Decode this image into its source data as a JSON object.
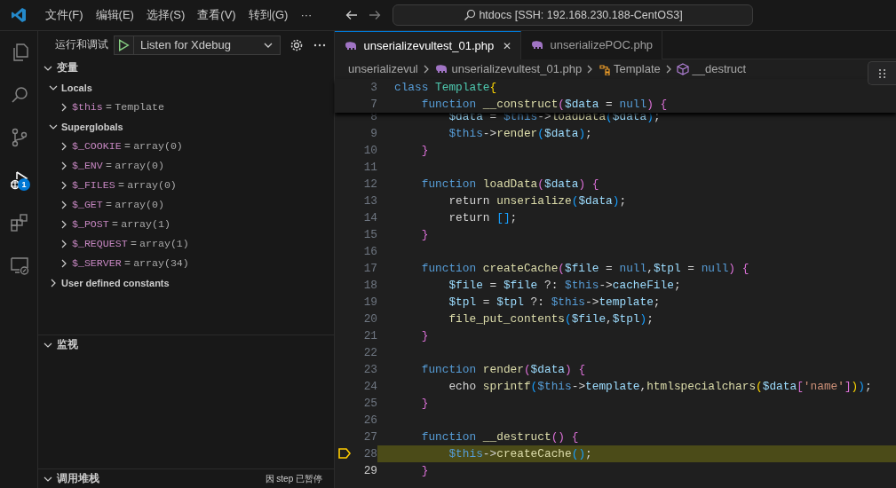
{
  "menu": [
    "文件(F)",
    "编辑(E)",
    "选择(S)",
    "查看(V)",
    "转到(G)",
    "···"
  ],
  "command_center": "htdocs [SSH: 192.168.230.188-CentOS3]",
  "activity_bar": [
    {
      "kind": "files",
      "selected": false
    },
    {
      "kind": "search",
      "selected": false
    },
    {
      "kind": "source-control",
      "selected": false
    },
    {
      "kind": "debug",
      "selected": true,
      "badge": "1"
    },
    {
      "kind": "extensions",
      "selected": false
    },
    {
      "kind": "remote",
      "selected": false
    }
  ],
  "sidebar": {
    "title": "运行和调试",
    "config": "Listen for Xdebug",
    "sections": [
      {
        "title": "变量",
        "expanded": true,
        "items": [
          {
            "label": "Locals",
            "expanded": true,
            "children": [
              {
                "name": "$this",
                "op": "=",
                "value": "Template",
                "expanded": false
              }
            ]
          },
          {
            "label": "Superglobals",
            "expanded": true,
            "children": [
              {
                "name": "$_COOKIE",
                "op": "=",
                "value": "array(0)",
                "expanded": false
              },
              {
                "name": "$_ENV",
                "op": "=",
                "value": "array(0)",
                "expanded": false
              },
              {
                "name": "$_FILES",
                "op": "=",
                "value": "array(0)",
                "expanded": false
              },
              {
                "name": "$_GET",
                "op": "=",
                "value": "array(0)",
                "expanded": false
              },
              {
                "name": "$_POST",
                "op": "=",
                "value": "array(1)",
                "expanded": false
              },
              {
                "name": "$_REQUEST",
                "op": "=",
                "value": "array(1)",
                "expanded": false
              },
              {
                "name": "$_SERVER",
                "op": "=",
                "value": "array(34)",
                "expanded": false
              }
            ]
          },
          {
            "label": "User defined constants",
            "expanded": false
          }
        ]
      },
      {
        "title": "监视",
        "expanded": true
      },
      {
        "title": "调用堆栈",
        "expanded": true,
        "status": "因 step 已暂停"
      }
    ]
  },
  "tabs": [
    {
      "label": "unserializevultest_01.php",
      "selected": true,
      "close": "✕"
    },
    {
      "label": "unserializePOC.php",
      "selected": false
    }
  ],
  "breadcrumbs": [
    {
      "kind": "folder",
      "label": "unserializevul"
    },
    {
      "kind": "file",
      "label": "unserializevultest_01.php"
    },
    {
      "kind": "class",
      "label": "Template"
    },
    {
      "kind": "method",
      "label": "__destruct"
    }
  ],
  "sticky_lines": [
    {
      "no": "3",
      "tokens": [
        {
          "text": "class ",
          "kind": "keyword"
        },
        {
          "text": "Template",
          "kind": "type"
        },
        {
          "text": "{",
          "kind": "b1"
        }
      ]
    },
    {
      "no": "7",
      "tokens": [
        {
          "text": "    function ",
          "kind": "keyword"
        },
        {
          "text": "__construct",
          "kind": "function"
        },
        {
          "text": "(",
          "kind": "b2"
        },
        {
          "text": "$data",
          "kind": "variable"
        },
        {
          "text": " = ",
          "kind": "plain"
        },
        {
          "text": "null",
          "kind": "keyword"
        },
        {
          "text": ")",
          "kind": "b2"
        },
        {
          "text": " {",
          "kind": "b2"
        }
      ]
    }
  ],
  "lines": [
    {
      "no": "8",
      "current": false,
      "cursor": false,
      "tokens": [
        {
          "text": "        $data",
          "kind": "variable"
        },
        {
          "text": " = ",
          "kind": "plain"
        },
        {
          "text": "$this",
          "kind": "keyword"
        },
        {
          "text": "->",
          "kind": "plain"
        },
        {
          "text": "loadData",
          "kind": "function"
        },
        {
          "text": "(",
          "kind": "b3"
        },
        {
          "text": "$data",
          "kind": "variable"
        },
        {
          "text": ")",
          "kind": "b3"
        },
        {
          "text": ";",
          "kind": "plain"
        }
      ]
    },
    {
      "no": "9",
      "current": false,
      "cursor": false,
      "tokens": [
        {
          "text": "        $this",
          "kind": "keyword"
        },
        {
          "text": "->",
          "kind": "plain"
        },
        {
          "text": "render",
          "kind": "function"
        },
        {
          "text": "(",
          "kind": "b3"
        },
        {
          "text": "$data",
          "kind": "variable"
        },
        {
          "text": ")",
          "kind": "b3"
        },
        {
          "text": ";",
          "kind": "plain"
        }
      ]
    },
    {
      "no": "10",
      "current": false,
      "cursor": false,
      "tokens": [
        {
          "text": "    }",
          "kind": "b2"
        }
      ]
    },
    {
      "no": "11",
      "current": false,
      "cursor": false
    },
    {
      "no": "12",
      "current": false,
      "cursor": false,
      "tokens": [
        {
          "text": "    function ",
          "kind": "keyword"
        },
        {
          "text": "loadData",
          "kind": "function"
        },
        {
          "text": "(",
          "kind": "b2"
        },
        {
          "text": "$data",
          "kind": "variable"
        },
        {
          "text": ")",
          "kind": "b2"
        },
        {
          "text": " {",
          "kind": "b2"
        }
      ]
    },
    {
      "no": "13",
      "current": false,
      "cursor": false,
      "tokens": [
        {
          "text": "        return ",
          "kind": "plain"
        },
        {
          "text": "unserialize",
          "kind": "function"
        },
        {
          "text": "(",
          "kind": "b3"
        },
        {
          "text": "$data",
          "kind": "variable"
        },
        {
          "text": ")",
          "kind": "b3"
        },
        {
          "text": ";",
          "kind": "plain"
        }
      ]
    },
    {
      "no": "14",
      "current": false,
      "cursor": false,
      "tokens": [
        {
          "text": "        return ",
          "kind": "plain"
        },
        {
          "text": "[]",
          "kind": "b3"
        },
        {
          "text": ";",
          "kind": "plain"
        }
      ]
    },
    {
      "no": "15",
      "current": false,
      "cursor": false,
      "tokens": [
        {
          "text": "    }",
          "kind": "b2"
        }
      ]
    },
    {
      "no": "16",
      "current": false,
      "cursor": false
    },
    {
      "no": "17",
      "current": false,
      "cursor": false,
      "tokens": [
        {
          "text": "    function ",
          "kind": "keyword"
        },
        {
          "text": "createCache",
          "kind": "function"
        },
        {
          "text": "(",
          "kind": "b2"
        },
        {
          "text": "$file",
          "kind": "variable"
        },
        {
          "text": " = ",
          "kind": "plain"
        },
        {
          "text": "null",
          "kind": "keyword"
        },
        {
          "text": ",",
          "kind": "plain"
        },
        {
          "text": "$tpl",
          "kind": "variable"
        },
        {
          "text": " = ",
          "kind": "plain"
        },
        {
          "text": "null",
          "kind": "keyword"
        },
        {
          "text": ")",
          "kind": "b2"
        },
        {
          "text": " {",
          "kind": "b2"
        }
      ]
    },
    {
      "no": "18",
      "current": false,
      "cursor": false,
      "tokens": [
        {
          "text": "        $file",
          "kind": "variable"
        },
        {
          "text": " = ",
          "kind": "plain"
        },
        {
          "text": "$file",
          "kind": "variable"
        },
        {
          "text": " ?: ",
          "kind": "plain"
        },
        {
          "text": "$this",
          "kind": "keyword"
        },
        {
          "text": "->",
          "kind": "plain"
        },
        {
          "text": "cacheFile",
          "kind": "variable"
        },
        {
          "text": ";",
          "kind": "plain"
        }
      ]
    },
    {
      "no": "19",
      "current": false,
      "cursor": false,
      "tokens": [
        {
          "text": "        $tpl",
          "kind": "variable"
        },
        {
          "text": " = ",
          "kind": "plain"
        },
        {
          "text": "$tpl",
          "kind": "variable"
        },
        {
          "text": " ?: ",
          "kind": "plain"
        },
        {
          "text": "$this",
          "kind": "keyword"
        },
        {
          "text": "->",
          "kind": "plain"
        },
        {
          "text": "template",
          "kind": "variable"
        },
        {
          "text": ";",
          "kind": "plain"
        }
      ]
    },
    {
      "no": "20",
      "current": false,
      "cursor": false,
      "tokens": [
        {
          "text": "        file_put_contents",
          "kind": "function"
        },
        {
          "text": "(",
          "kind": "b3"
        },
        {
          "text": "$file",
          "kind": "variable"
        },
        {
          "text": ",",
          "kind": "plain"
        },
        {
          "text": "$tpl",
          "kind": "variable"
        },
        {
          "text": ")",
          "kind": "b3"
        },
        {
          "text": ";",
          "kind": "plain"
        }
      ]
    },
    {
      "no": "21",
      "current": false,
      "cursor": false,
      "tokens": [
        {
          "text": "    }",
          "kind": "b2"
        }
      ]
    },
    {
      "no": "22",
      "current": false,
      "cursor": false
    },
    {
      "no": "23",
      "current": false,
      "cursor": false,
      "tokens": [
        {
          "text": "    function ",
          "kind": "keyword"
        },
        {
          "text": "render",
          "kind": "function"
        },
        {
          "text": "(",
          "kind": "b2"
        },
        {
          "text": "$data",
          "kind": "variable"
        },
        {
          "text": ")",
          "kind": "b2"
        },
        {
          "text": " {",
          "kind": "b2"
        }
      ]
    },
    {
      "no": "24",
      "current": false,
      "cursor": false,
      "tokens": [
        {
          "text": "        echo ",
          "kind": "plain"
        },
        {
          "text": "sprintf",
          "kind": "function"
        },
        {
          "text": "(",
          "kind": "b3"
        },
        {
          "text": "$this",
          "kind": "keyword"
        },
        {
          "text": "->",
          "kind": "plain"
        },
        {
          "text": "template",
          "kind": "variable"
        },
        {
          "text": ",",
          "kind": "plain"
        },
        {
          "text": "htmlspecialchars",
          "kind": "function"
        },
        {
          "text": "(",
          "kind": "b1"
        },
        {
          "text": "$data",
          "kind": "variable"
        },
        {
          "text": "[",
          "kind": "b2"
        },
        {
          "text": "'name'",
          "kind": "string"
        },
        {
          "text": "]",
          "kind": "b2"
        },
        {
          "text": ")",
          "kind": "b1"
        },
        {
          "text": ")",
          "kind": "b3"
        },
        {
          "text": ";",
          "kind": "plain"
        }
      ]
    },
    {
      "no": "25",
      "current": false,
      "cursor": false,
      "tokens": [
        {
          "text": "    }",
          "kind": "b2"
        }
      ]
    },
    {
      "no": "26",
      "current": false,
      "cursor": false
    },
    {
      "no": "27",
      "current": false,
      "cursor": false,
      "tokens": [
        {
          "text": "    function ",
          "kind": "keyword"
        },
        {
          "text": "__destruct",
          "kind": "function"
        },
        {
          "text": "(",
          "kind": "b2"
        },
        {
          "text": ")",
          "kind": "b2"
        },
        {
          "text": " {",
          "kind": "b2"
        }
      ]
    },
    {
      "no": "28",
      "current": true,
      "cursor": false,
      "tokens": [
        {
          "text": "        $this",
          "kind": "keyword"
        },
        {
          "text": "->",
          "kind": "plain"
        },
        {
          "text": "createCache",
          "kind": "function"
        },
        {
          "text": "(",
          "kind": "b3"
        },
        {
          "text": ")",
          "kind": "b3"
        },
        {
          "text": ";",
          "kind": "plain"
        }
      ]
    },
    {
      "no": "29",
      "current": false,
      "cursor": true,
      "tokens": [
        {
          "text": "    }",
          "kind": "b2"
        }
      ]
    }
  ]
}
